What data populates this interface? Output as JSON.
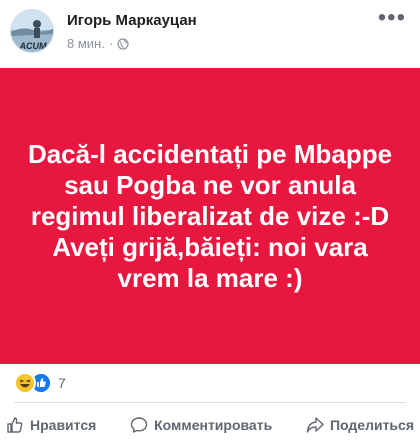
{
  "post": {
    "author": "Игорь Маркауцан",
    "time": "8 мин.",
    "privacy_icon": "globe-icon",
    "menu_icon": "more-options-icon",
    "background_color": "#e8173f",
    "text": "Dacă-l accidentați pe Mbappe sau Pogba ne vor anula regimul liberalizat de vize :-D Aveți grijă,băieți: noi vara vrem la mare :)"
  },
  "avatar": {
    "logo_text": "ACUM"
  },
  "reactions": {
    "icons": [
      "haha-reaction-icon",
      "like-reaction-icon"
    ],
    "count": "7"
  },
  "actions": {
    "like_label": "Нравится",
    "comment_label": "Комментировать",
    "share_label": "Поделиться"
  }
}
